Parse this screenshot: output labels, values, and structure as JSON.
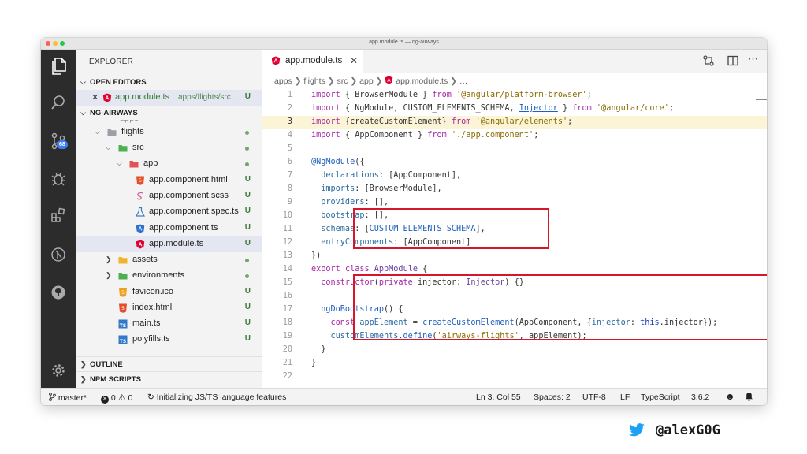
{
  "window": {
    "title": "app.module.ts — ng-airways"
  },
  "activity_bar": {
    "badge": "68"
  },
  "sidebar": {
    "title": "EXPLORER",
    "open_editors_label": "OPEN EDITORS",
    "open_editor": {
      "name": "app.module.ts",
      "path": "apps/flights/src...",
      "status": "U"
    },
    "project_label": "NG-AIRWAYS",
    "tree": [
      {
        "label": "flights",
        "status": ""
      },
      {
        "label": "src",
        "status": ""
      },
      {
        "label": "app",
        "status": ""
      },
      {
        "label": "app.component.html",
        "status": "U"
      },
      {
        "label": "app.component.scss",
        "status": "U"
      },
      {
        "label": "app.component.spec.ts",
        "status": "U"
      },
      {
        "label": "app.component.ts",
        "status": "U"
      },
      {
        "label": "app.module.ts",
        "status": "U"
      },
      {
        "label": "assets",
        "status": ""
      },
      {
        "label": "environments",
        "status": ""
      },
      {
        "label": "favicon.ico",
        "status": "U"
      },
      {
        "label": "index.html",
        "status": "U"
      },
      {
        "label": "main.ts",
        "status": "U"
      },
      {
        "label": "polyfills.ts",
        "status": "U"
      }
    ],
    "outline_label": "OUTLINE",
    "npm_label": "NPM SCRIPTS"
  },
  "editor": {
    "tab_label": "app.module.ts",
    "breadcrumb": [
      "apps",
      "flights",
      "src",
      "app",
      "app.module.ts",
      "…"
    ],
    "line_numbers": [
      "1",
      "2",
      "3",
      "4",
      "5",
      "6",
      "7",
      "8",
      "9",
      "10",
      "11",
      "12",
      "13",
      "14",
      "15",
      "16",
      "17",
      "18",
      "19",
      "20",
      "21",
      "22"
    ],
    "code": {
      "l1_a": "import",
      "l1_b": " { BrowserModule } ",
      "l1_c": "from",
      "l1_d": "'@angular/platform-browser'",
      "l1_e": ";",
      "l2_a": "import",
      "l2_b": " { NgModule, CUSTOM_ELEMENTS_SCHEMA, ",
      "l2_c": "Injector",
      "l2_d": " } ",
      "l2_e": "from",
      "l2_f": "'@angular/core'",
      "l2_g": ";",
      "l3_a": "import",
      "l3_b": " {createCustomElement} ",
      "l3_c": "from",
      "l3_d": "'@angular/elements'",
      "l3_e": ";",
      "l4_a": "import",
      "l4_b": " { AppComponent } ",
      "l4_c": "from",
      "l4_d": "'./app.component'",
      "l4_e": ";",
      "l6_a": "@NgModule",
      "l6_b": "({",
      "l7_a": "  declarations",
      "l7_b": ": [AppComponent],",
      "l8_a": "  imports",
      "l8_b": ": [BrowserModule],",
      "l9_a": "  providers",
      "l9_b": ": [],",
      "l10_a": "  bootstrap",
      "l10_b": ": [],",
      "l11_a": "  schemas",
      "l11_b": ": [",
      "l11_c": "CUSTOM_ELEMENTS_SCHEMA",
      "l11_d": "],",
      "l12_a": "  entryComponents",
      "l12_b": ": [AppComponent]",
      "l13": "})",
      "l14_a": "export",
      "l14_b": " ",
      "l14_c": "class",
      "l14_d": " ",
      "l14_e": "AppModule",
      "l14_f": " {",
      "l15_a": "  constructor",
      "l15_b": "(",
      "l15_c": "private",
      "l15_d": " injector",
      "l15_e": ": ",
      "l15_f": "Injector",
      "l15_g": ") {}",
      "l17_a": "  ngDoBootstrap",
      "l17_b": "() {",
      "l18_a": "    const",
      "l18_b": " appElement",
      "l18_c": " = ",
      "l18_d": "createCustomElement",
      "l18_e": "(AppComponent, {",
      "l18_f": "injector",
      "l18_g": ": ",
      "l18_h": "this",
      "l18_i": ".injector});",
      "l19_a": "    customElements",
      "l19_b": ".",
      "l19_c": "define",
      "l19_d": "(",
      "l19_e": "'airways-flights'",
      "l19_f": ", appElement);",
      "l20": "  }",
      "l21": "}"
    }
  },
  "status_bar": {
    "branch": "master*",
    "errors": "0",
    "warnings": "0",
    "task": "Initializing JS/TS language features",
    "position": "Ln 3, Col 55",
    "spaces": "Spaces: 2",
    "encoding": "UTF-8",
    "eol": "LF",
    "language": "TypeScript",
    "version": "3.6.2"
  },
  "twitter_handle": "@alexG0G",
  "colors": {
    "highlight_box": "#d6162a",
    "angular_red": "#dd0031",
    "folder_green": "#4caf50",
    "badge_blue": "#3d7ef5"
  }
}
